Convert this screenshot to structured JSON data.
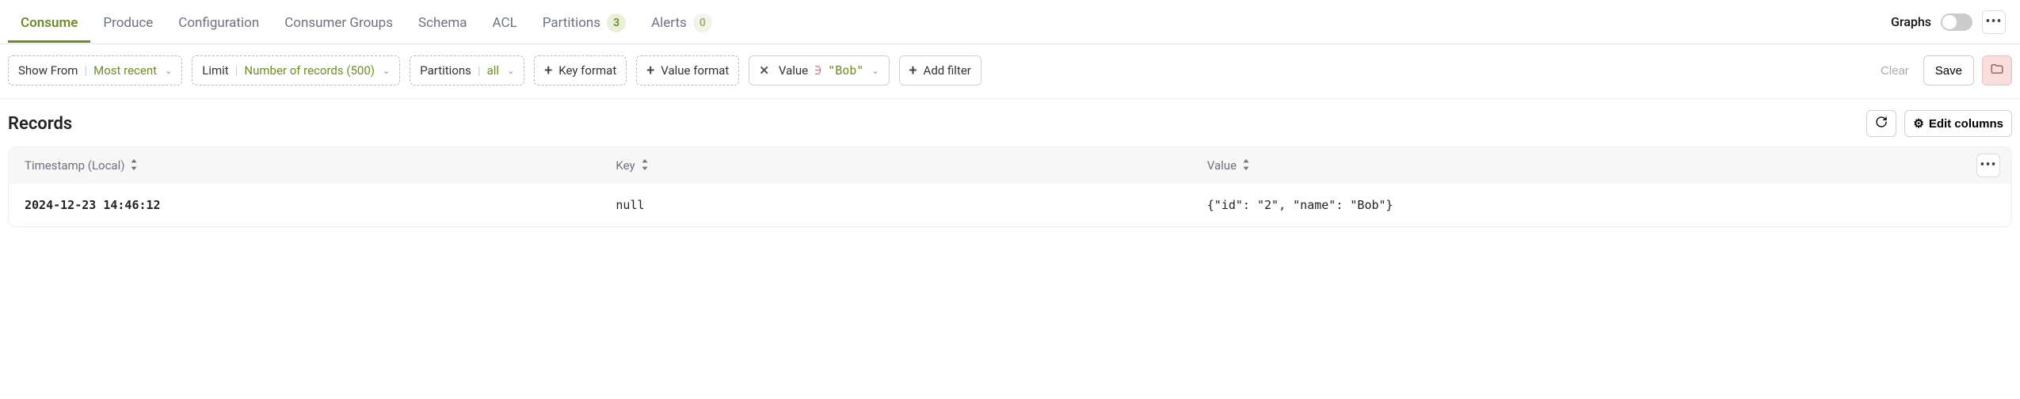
{
  "tabs": {
    "consume": "Consume",
    "produce": "Produce",
    "configuration": "Configuration",
    "consumer_groups": "Consumer Groups",
    "schema": "Schema",
    "acl": "ACL",
    "partitions": "Partitions",
    "partitions_badge": "3",
    "alerts": "Alerts",
    "alerts_badge": "0"
  },
  "topRight": {
    "graphs_label": "Graphs"
  },
  "filters": {
    "show_from_label": "Show From",
    "show_from_value": "Most recent",
    "limit_label": "Limit",
    "limit_value": "Number of records (500)",
    "partitions_label": "Partitions",
    "partitions_value": "all",
    "key_format": "Key format",
    "value_format": "Value format",
    "value_filter_field": "Value",
    "value_filter_op": "∋",
    "value_filter_val": "\"Bob\"",
    "add_filter": "Add filter",
    "clear": "Clear",
    "save": "Save"
  },
  "records": {
    "title": "Records",
    "edit_columns": "Edit columns",
    "columns": {
      "timestamp": "Timestamp (Local)",
      "key": "Key",
      "value": "Value"
    },
    "rows": [
      {
        "timestamp": "2024-12-23 14:46:12",
        "key": "null",
        "value": "{\"id\": \"2\", \"name\": \"Bob\"}"
      }
    ]
  }
}
